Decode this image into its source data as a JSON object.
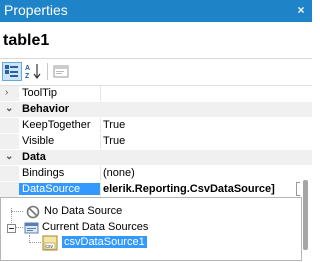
{
  "window": {
    "title": "Properties",
    "close_glyph": "×",
    "accent": "#1f83c8"
  },
  "object_name": "table1",
  "toolbar": {
    "buttons": [
      "categorized-icon",
      "alphabetical-icon",
      "property-pages-icon"
    ]
  },
  "grid": {
    "rows": [
      {
        "kind": "prop",
        "name": "ToolTip",
        "value": "",
        "collapsed": true
      },
      {
        "kind": "category",
        "name": "Behavior"
      },
      {
        "kind": "prop",
        "name": "KeepTogether",
        "value": "True"
      },
      {
        "kind": "prop",
        "name": "Visible",
        "value": "True"
      },
      {
        "kind": "category",
        "name": "Data"
      },
      {
        "kind": "prop",
        "name": "Bindings",
        "value": "(none)"
      },
      {
        "kind": "prop",
        "name": "DataSource",
        "value": "elerik.Reporting.CsvDataSource]",
        "selected": true
      }
    ]
  },
  "datasource_popup": {
    "items": [
      {
        "label": "No Data Source",
        "icon": "no-entry-icon"
      },
      {
        "label": "Current Data Sources",
        "icon": "data-sources-icon"
      },
      {
        "label": "csvDataSource1",
        "icon": "csv-icon",
        "selected": true
      }
    ]
  }
}
